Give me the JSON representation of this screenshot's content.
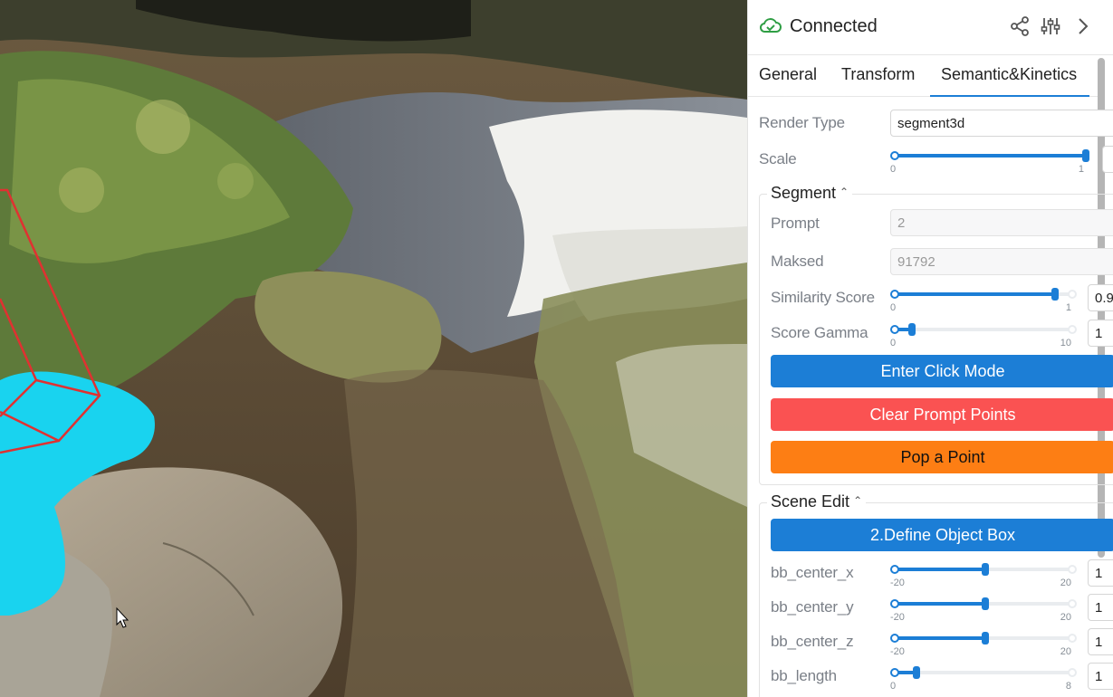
{
  "status": {
    "text": "Connected",
    "icon": "cloud-check-icon",
    "color": "#2f9e44"
  },
  "header_icons": [
    "share-icon",
    "sliders-icon",
    "chevron-right-icon"
  ],
  "tabs": [
    {
      "label": "General",
      "active": false
    },
    {
      "label": "Transform",
      "active": false
    },
    {
      "label": "Semantic&Kinetics",
      "active": true
    }
  ],
  "render_type": {
    "label": "Render Type",
    "value": "segment3d"
  },
  "scale": {
    "label": "Scale",
    "min": "0",
    "max": "1",
    "value": 1.0,
    "fraction": 1.0
  },
  "segment": {
    "title": "Segment",
    "prompt": {
      "label": "Prompt",
      "value": "2"
    },
    "masked": {
      "label": "Maksed",
      "value": "91792"
    },
    "similarity": {
      "label": "Similarity Score",
      "min": "0",
      "max": "1",
      "value": "0.9",
      "fraction": 0.9
    },
    "gamma": {
      "label": "Score Gamma",
      "min": "0",
      "max": "10",
      "value": "1",
      "fraction": 0.1
    },
    "buttons": {
      "click_mode": "Enter Click Mode",
      "clear": "Clear Prompt Points",
      "pop": "Pop a Point"
    }
  },
  "scene_edit": {
    "title": "Scene Edit",
    "define_box": "2.Define Object Box",
    "params": [
      {
        "label": "bb_center_x",
        "min": "-20",
        "max": "20",
        "value": "1",
        "fraction": 0.51
      },
      {
        "label": "bb_center_y",
        "min": "-20",
        "max": "20",
        "value": "1",
        "fraction": 0.51
      },
      {
        "label": "bb_center_z",
        "min": "-20",
        "max": "20",
        "value": "1",
        "fraction": 0.51
      },
      {
        "label": "bb_length",
        "min": "0",
        "max": "8",
        "value": "1",
        "fraction": 0.125
      }
    ]
  },
  "colors": {
    "accent": "#1c7ed6",
    "clear_button": "#fa5252",
    "pop_button": "#fd7e14",
    "segment_mask": "#19d3ef",
    "bbox": "#e03131"
  }
}
